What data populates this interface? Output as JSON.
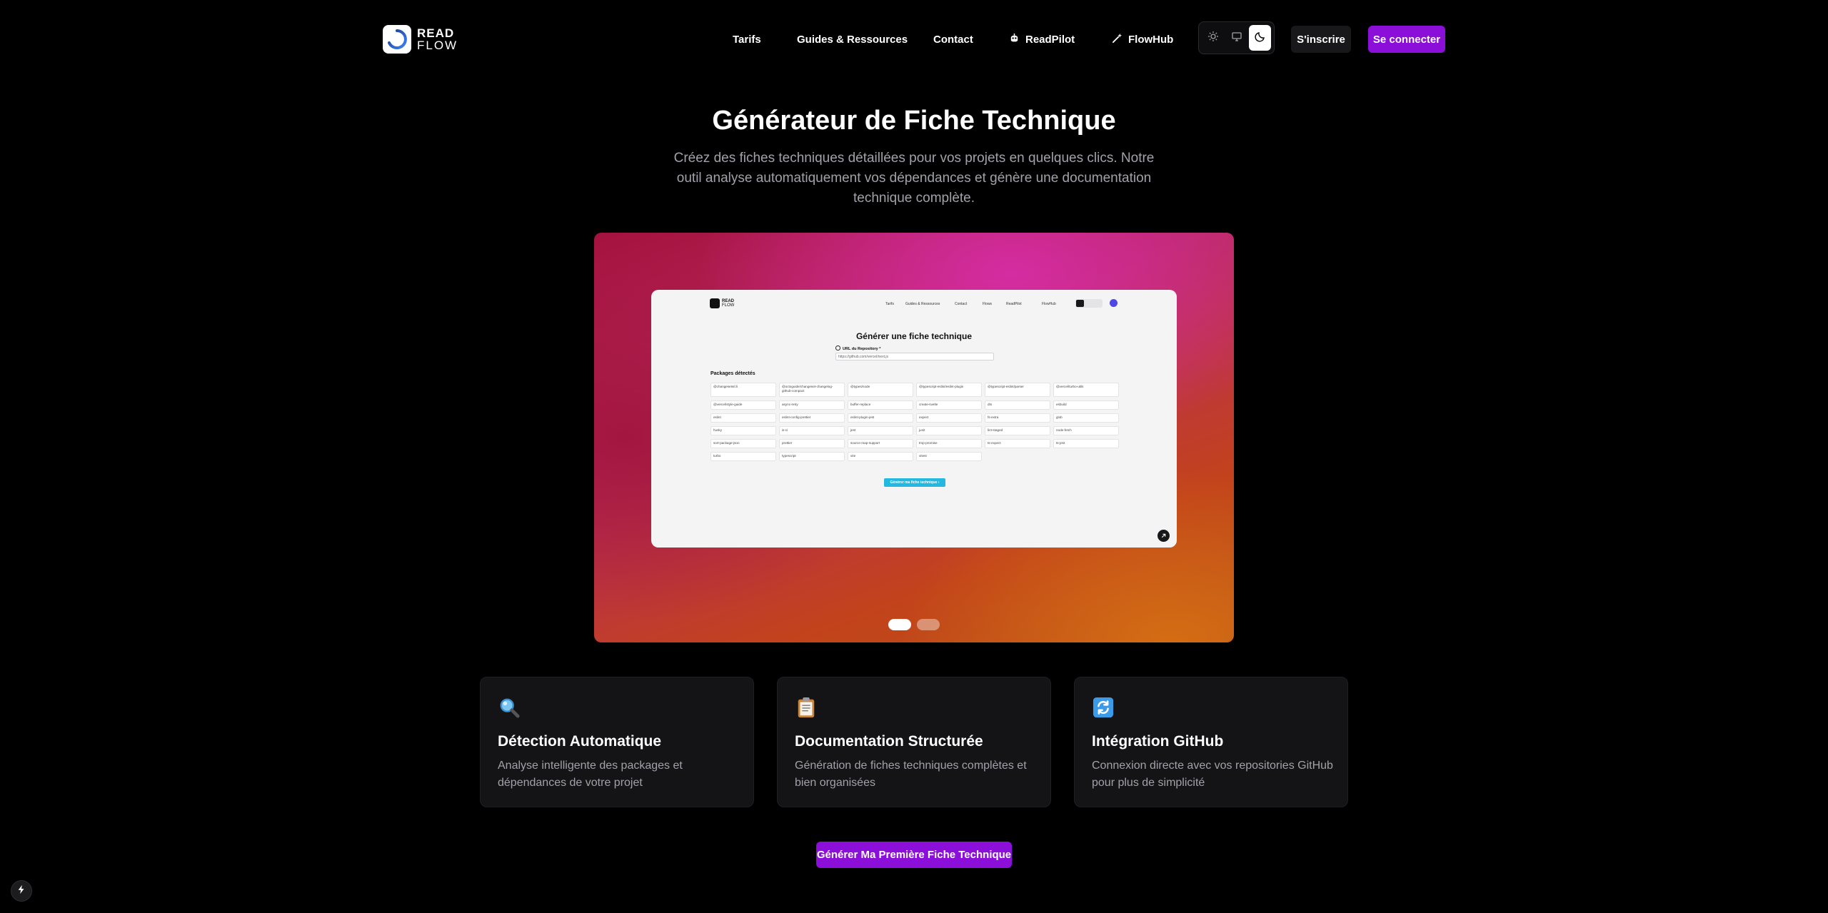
{
  "header": {
    "logo_top": "READ",
    "logo_bottom": "FLOW",
    "nav": [
      {
        "label": "Tarifs"
      },
      {
        "label": "Guides & Ressources"
      },
      {
        "label": "Contact"
      },
      {
        "label": "ReadPilot",
        "icon": "readpilot-icon"
      },
      {
        "label": "FlowHub",
        "icon": "magic-wand-icon"
      }
    ],
    "theme_options": [
      "sun-icon",
      "monitor-icon",
      "moon-icon"
    ],
    "theme_selected": "dark",
    "signup_label": "S'inscrire",
    "login_label": "Se connecter"
  },
  "hero": {
    "title": "Générateur de Fiche Technique",
    "subtitle": "Créez des fiches techniques détaillées pour vos projets en quelques clics. Notre outil analyse automatiquement vos dépendances et génère une documentation technique complète."
  },
  "showcase": {
    "mock": {
      "logo_top": "READ",
      "logo_bottom": "FLOW",
      "nav": [
        "Tarifs",
        "Guides & Ressources",
        "Contact",
        "Flows",
        "ReadPilot",
        "FlowHub"
      ],
      "title": "Générer une fiche technique",
      "repo_label": "URL du Repository *",
      "repo_value": "https://github.com/vercel/next.js",
      "packages_title": "Packages détectés",
      "packages": [
        "@changesets/cli",
        "@octoguide/changeset-changelog-github-compact",
        "@types/node",
        "@typescript-eslint/eslint-plugin",
        "@typescript-eslint/parser",
        "@vercel/turbo-utils",
        "@vercel/style-guide",
        "async-retry",
        "buffer-replace",
        "create-svelte",
        "dts",
        "esbuild",
        "eslint",
        "eslint-config-prettier",
        "eslint-plugin-jest",
        "expect",
        "fs-extra",
        "glob",
        "husky",
        "is-ci",
        "jest",
        "junit",
        "lint-staged",
        "node-fetch",
        "sort-package-json",
        "prettier",
        "source-map-support",
        "tmp-promise",
        "ts-expect",
        "ts-jest",
        "turbo",
        "typescript",
        "vite",
        "vitest"
      ],
      "generate_label": "Générer ma fiche technique"
    },
    "slides_total": 2,
    "slide_active": 1
  },
  "features": [
    {
      "icon": "magnifier-icon",
      "title": "Détection Automatique",
      "desc": "Analyse intelligente des packages et dépendances de votre projet"
    },
    {
      "icon": "clipboard-icon",
      "title": "Documentation Structurée",
      "desc": "Génération de fiches techniques complètes et bien organisées"
    },
    {
      "icon": "sync-icon",
      "title": "Intégration GitHub",
      "desc": "Connexion directe avec vos repositories GitHub pour plus de simplicité"
    }
  ],
  "cta_label": "Générer Ma Première Fiche Technique",
  "colors": {
    "accent": "#8b0fd8",
    "background": "#000000",
    "card": "#141416",
    "muted_text": "#a1a1aa"
  }
}
